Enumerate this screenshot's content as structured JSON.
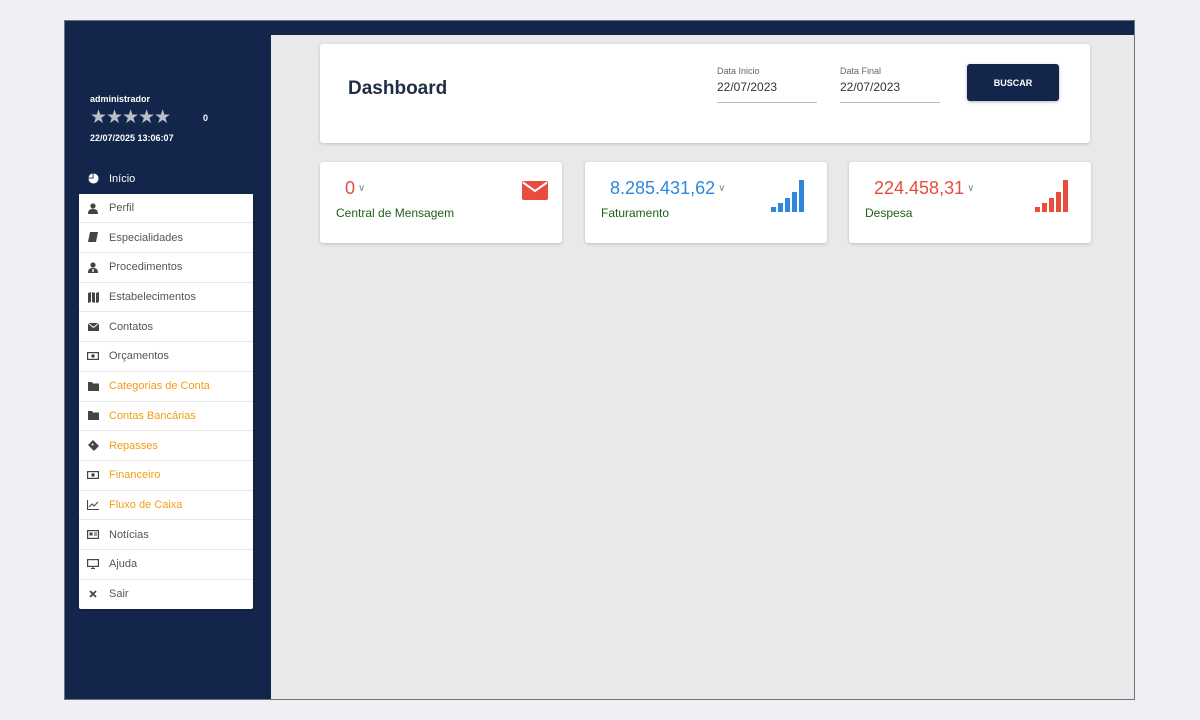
{
  "user": {
    "name": "administrador",
    "stars": "★★★★★",
    "rating_count": "0",
    "datetime": "22/07/2025 13:06:07"
  },
  "menu": [
    {
      "label": "Início",
      "icon": "pie-chart-icon",
      "style": "active"
    },
    {
      "label": "Perfil",
      "icon": "user-icon",
      "style": "normal"
    },
    {
      "label": "Especialidades",
      "icon": "book-icon",
      "style": "normal"
    },
    {
      "label": "Procedimentos",
      "icon": "user-md-icon",
      "style": "normal"
    },
    {
      "label": "Estabelecimentos",
      "icon": "map-icon",
      "style": "normal"
    },
    {
      "label": "Contatos",
      "icon": "envelope-icon",
      "style": "normal"
    },
    {
      "label": "Orçamentos",
      "icon": "money-icon",
      "style": "normal"
    },
    {
      "label": "Categorias de Conta",
      "icon": "folder-icon",
      "style": "orange"
    },
    {
      "label": "Contas Bancárias",
      "icon": "folder-icon",
      "style": "orange"
    },
    {
      "label": "Repasses",
      "icon": "ticket-icon",
      "style": "orange"
    },
    {
      "label": "Financeiro",
      "icon": "money-icon",
      "style": "orange"
    },
    {
      "label": "Fluxo de Caixa",
      "icon": "line-chart-icon",
      "style": "orange"
    },
    {
      "label": "Notícias",
      "icon": "newspaper-icon",
      "style": "normal"
    },
    {
      "label": "Ajuda",
      "icon": "monitor-icon",
      "style": "normal"
    },
    {
      "label": "Sair",
      "icon": "close-icon",
      "style": "normal"
    }
  ],
  "header": {
    "title": "Dashboard",
    "start_label": "Data Inicio",
    "start_value": "22/07/2023",
    "end_label": "Data Final",
    "end_value": "22/07/2023",
    "search_label": "BUSCAR"
  },
  "cards": {
    "messages": {
      "value": "0",
      "label": "Central de Mensagem",
      "color": "#e74c3c",
      "icon": "envelope-icon"
    },
    "revenue": {
      "value": "8.285.431,62",
      "label": "Faturamento",
      "color": "#2e86de",
      "icon": "signal-bars-icon"
    },
    "expense": {
      "value": "224.458,31",
      "label": "Despesa",
      "color": "#e74c3c",
      "icon": "signal-bars-icon"
    }
  },
  "colors": {
    "navy": "#13254a",
    "orange": "#f39c12",
    "label_green": "#1f5e1a"
  }
}
